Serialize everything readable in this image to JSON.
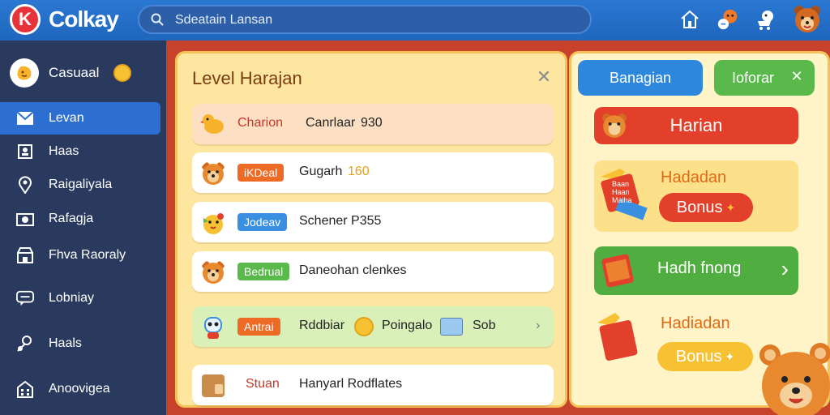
{
  "app": {
    "logo_mark": "K",
    "name": "Colkay"
  },
  "search": {
    "placeholder": "Sdeatain Lansan"
  },
  "sidebar": {
    "header": "Casuaal",
    "items": [
      {
        "label": "Levan",
        "icon": "mail-icon",
        "active": true
      },
      {
        "label": "Haas",
        "icon": "contact-card-icon"
      },
      {
        "label": "Raigaliyala",
        "icon": "location-pin-icon"
      },
      {
        "label": "Rafagja",
        "icon": "camera-icon"
      },
      {
        "label": "Fhva Raoraly",
        "icon": "shop-icon"
      },
      {
        "label": "Lobniay",
        "icon": "chat-icon"
      },
      {
        "label": "Haals",
        "icon": "user-icon"
      },
      {
        "label": "Anoovigea",
        "icon": "building-icon"
      }
    ]
  },
  "panel": {
    "title": "Level Harajan",
    "rows": [
      {
        "badge": "",
        "badge_color": "",
        "text_label": "Charion",
        "text": "Canrlaar",
        "value": "930"
      },
      {
        "badge": "iKDeal",
        "badge_color": "#ee6b26",
        "text": "Gugarh",
        "value": "160"
      },
      {
        "badge": "Jodeav",
        "badge_color": "#3b8fe0",
        "text": "Schener P355",
        "value": ""
      },
      {
        "badge": "Bedrual",
        "badge_color": "#59b94a",
        "text": "Daneohan clenkes",
        "value": ""
      },
      {
        "badge": "Antrai",
        "badge_color": "#ee6b26",
        "text": "Rddbiar",
        "extra1": "Poingalo",
        "extra2": "Sob"
      },
      {
        "badge": "",
        "badge_color": "",
        "text_label": "Stuan",
        "text": "Hanyarl Rodflates",
        "value": ""
      }
    ]
  },
  "right": {
    "tab1": "Banagian",
    "tab2": "Ioforar",
    "harian": "Harian",
    "card1_title": "Hadadan",
    "bonus1": "Bonus",
    "hadh": "Hadh fnong",
    "card2_title": "Hadiadan",
    "bonus2": "Bonus",
    "ticket_text": "Baan Haan Maiha"
  },
  "colors": {
    "topbar": "#1f66bd",
    "sidebar": "#2a3a5e",
    "accent_red": "#e2402a",
    "accent_green": "#59b94a",
    "panel_bg": "#fde7a0"
  }
}
